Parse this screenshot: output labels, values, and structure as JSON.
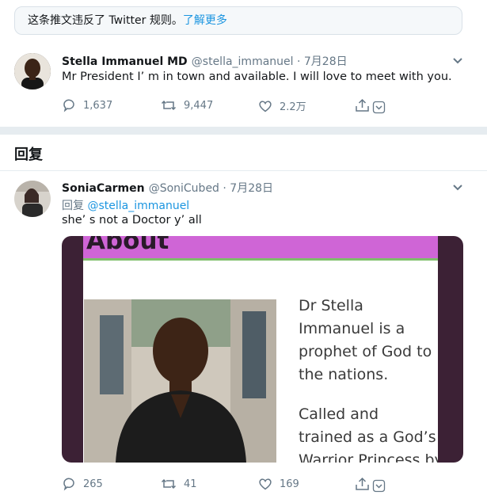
{
  "notice": {
    "text": "这条推文违反了 Twitter 规则。",
    "link": "了解更多"
  },
  "tweet1": {
    "name": "Stella Immanuel MD",
    "handle_date": "@stella_immanuel · 7月28日",
    "text": "Mr President I’ m in town and available. I will love to meet with you.",
    "replies": "1,637",
    "retweets": "9,447",
    "likes": "2.2万"
  },
  "section": {
    "title": "回复"
  },
  "tweet2": {
    "name": "SoniaCarmen",
    "handle_date": "@SoniCubed · 7月28日",
    "reply_prefix": "回复",
    "reply_to": "@stella_immanuel",
    "text": "she’ s not a Doctor y’ all",
    "replies": "265",
    "retweets": "41",
    "likes": "169",
    "media": {
      "heading": "About",
      "lines": [
        "Dr Stella",
        "Immanuel is a",
        "prophet of God to",
        "the nations.",
        "Called and",
        "trained as a God’s",
        "Warrior Princess by"
      ]
    }
  },
  "colors": {
    "link": "#1b95e0",
    "muted": "#657786",
    "divider": "#e6ecf0",
    "slide_band": "#cf65d6"
  }
}
